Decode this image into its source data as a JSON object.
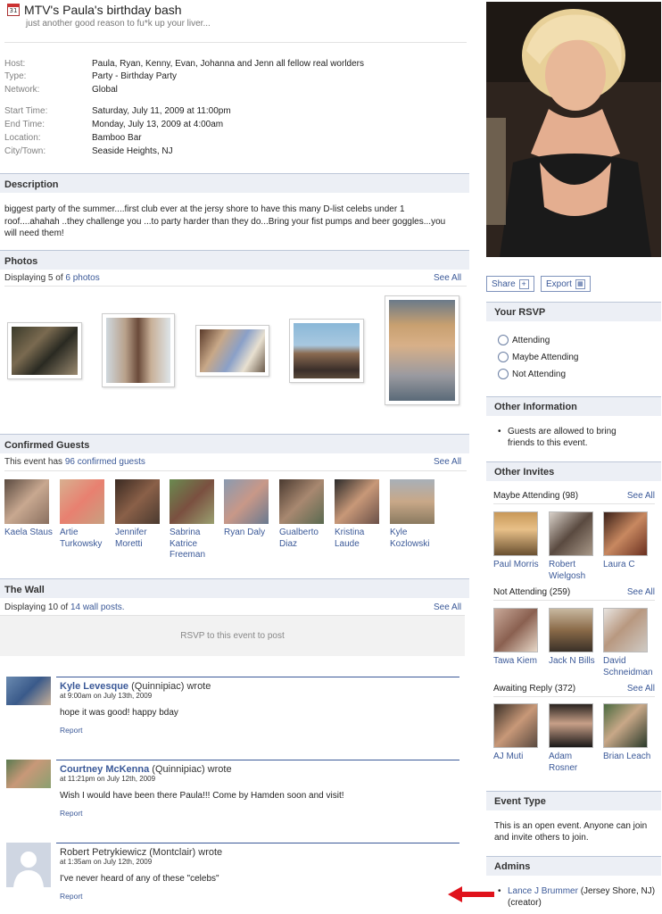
{
  "event": {
    "title": "MTV's Paula's birthday bash",
    "tagline": "just another good reason to fu*k up your liver...",
    "calendar_day": "31"
  },
  "info": [
    {
      "label": "Host:",
      "value": "Paula, Ryan, Kenny, Evan, Johanna and Jenn all fellow real worlders"
    },
    {
      "label": "Type:",
      "value": "Party - Birthday Party"
    },
    {
      "label": "Network:",
      "value": "Global"
    },
    {
      "label": "Start Time:",
      "value": "Saturday, July 11, 2009 at 11:00pm"
    },
    {
      "label": "End Time:",
      "value": "Monday, July 13, 2009 at 4:00am"
    },
    {
      "label": "Location:",
      "value": "Bamboo Bar"
    },
    {
      "label": "City/Town:",
      "value": "Seaside Heights, NJ"
    }
  ],
  "description": {
    "header": "Description",
    "text": "biggest party of the summer....first club ever at the jersy shore to have this many D-list celebs under 1 roof....ahahah ..they challenge you ...to party harder than they do...Bring your fist pumps and beer goggles...you will need them!"
  },
  "photos": {
    "header": "Photos",
    "summary_prefix": "Displaying 5 of ",
    "summary_link": "6 photos",
    "see_all": "See All"
  },
  "guests": {
    "header": "Confirmed Guests",
    "summary_prefix": "This event has ",
    "summary_link": "96 confirmed guests",
    "see_all": "See All",
    "items": [
      {
        "name": "Kaela Staus"
      },
      {
        "name": "Artie Turkowsky"
      },
      {
        "name": "Jennifer Moretti"
      },
      {
        "name": "Sabrina Katrice Freeman"
      },
      {
        "name": "Ryan Daly"
      },
      {
        "name": "Gualberto Diaz"
      },
      {
        "name": "Kristina Laude"
      },
      {
        "name": "Kyle Kozlowski"
      }
    ]
  },
  "wall": {
    "header": "The Wall",
    "summary_prefix": "Displaying 10 of ",
    "summary_link": "14 wall posts.",
    "see_all": "See All",
    "rsvp_prompt": "RSVP to this event to post",
    "posts": [
      {
        "author": "Kyle Levesque",
        "network": " (Quinnipiac) wrote",
        "time": "at 9:00am on July 13th, 2009",
        "message": "hope it was good! happy bday",
        "report": "Report"
      },
      {
        "author": "Courtney McKenna",
        "network": " (Quinnipiac) wrote",
        "time": "at 11:21pm on July 12th, 2009",
        "message": "Wish I would have been there Paula!!! Come by Hamden soon and visit!",
        "report": "Report"
      },
      {
        "author": "Robert Petrykiewicz",
        "network": " (Montclair) wrote",
        "time": "at 1:35am on July 12th, 2009",
        "message": "I've never heard of any of these \"celebs\"",
        "report": "Report"
      }
    ]
  },
  "actions": {
    "share": "Share",
    "share_icon": "+",
    "export": "Export"
  },
  "rsvp": {
    "header": "Your RSVP",
    "options": [
      "Attending",
      "Maybe Attending",
      "Not Attending"
    ]
  },
  "other_info": {
    "header": "Other Information",
    "bullet": "Guests are allowed to bring friends to this event."
  },
  "invites": {
    "header": "Other Invites",
    "see_all": "See All",
    "maybe": {
      "label": "Maybe Attending (98)",
      "people": [
        "Paul Morris",
        "Robert Wielgosh",
        "Laura C"
      ]
    },
    "not": {
      "label": "Not Attending (259)",
      "people": [
        "Tawa Kiem",
        "Jack N Bills",
        "David Schneidman"
      ]
    },
    "awaiting": {
      "label": "Awaiting Reply (372)",
      "people": [
        "AJ Muti",
        "Adam Rosner",
        "Brian Leach"
      ]
    }
  },
  "event_type": {
    "header": "Event Type",
    "text": "This is an open event. Anyone can join and invite others to join."
  },
  "admins": {
    "header": "Admins",
    "name": "Lance J Brummer",
    "detail": " (Jersey Shore, NJ) (creator)"
  },
  "colors": {
    "link": "#3b5998",
    "header_bg": "#eceff5",
    "header_border": "#bdc7d8",
    "arrow": "#e0121b"
  }
}
